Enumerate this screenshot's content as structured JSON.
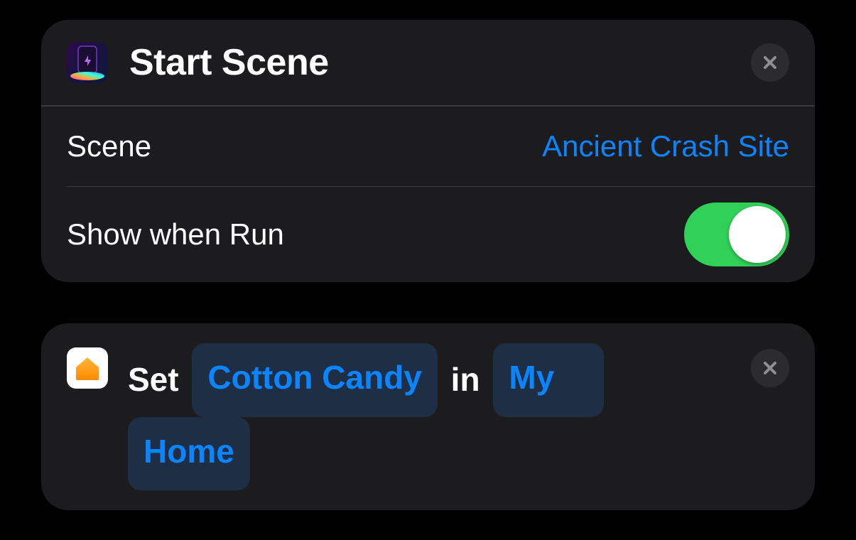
{
  "card1": {
    "title": "Start Scene",
    "rows": {
      "scene": {
        "label": "Scene",
        "value": "Ancient Crash Site"
      },
      "showWhenRun": {
        "label": "Show when Run",
        "toggle_on": true
      }
    }
  },
  "card2": {
    "sentence": {
      "prefix": "Set",
      "token_scene": "Cotton Candy",
      "middle": "in",
      "token_home_a": "My",
      "token_home_b": "Home"
    }
  }
}
